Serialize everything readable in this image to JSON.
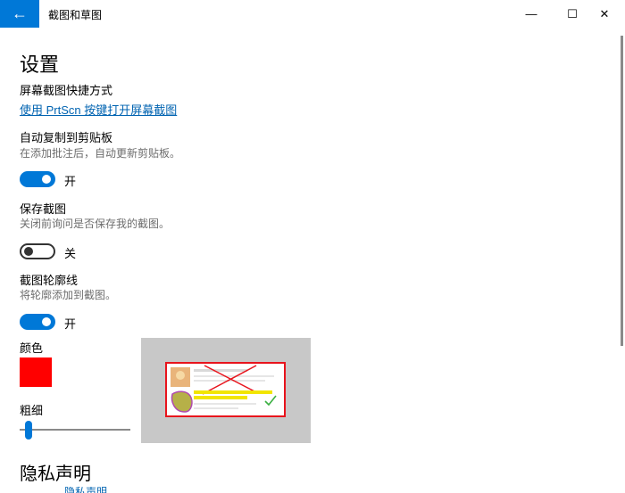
{
  "window": {
    "title": "截图和草图",
    "back_glyph": "←",
    "minimize_glyph": "—",
    "maximize_glyph": "☐",
    "close_glyph": "✕"
  },
  "heading": "设置",
  "shortcut": {
    "label": "屏幕截图快捷方式",
    "link": "使用 PrtScn 按键打开屏幕截图"
  },
  "auto_copy": {
    "label": "自动复制到剪贴板",
    "desc": "在添加批注后，自动更新剪贴板。",
    "state": "开",
    "on": true
  },
  "save_snip": {
    "label": "保存截图",
    "desc": "关闭前询问是否保存我的截图。",
    "state": "关",
    "on": false
  },
  "outline": {
    "label": "截图轮廓线",
    "desc": "将轮廓添加到截图。",
    "state": "开",
    "on": true,
    "color_label": "颜色",
    "color": "#ff0000",
    "thickness_label": "粗细",
    "thickness_fraction": 0.05
  },
  "privacy": {
    "heading": "隐私声明",
    "link": "隐私声明"
  },
  "colors": {
    "accent": "#0078d7",
    "link": "#0063b1",
    "outline_red": "#ff0000"
  }
}
